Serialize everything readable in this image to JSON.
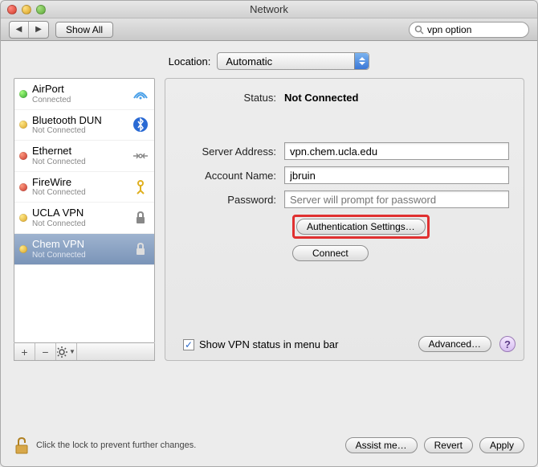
{
  "window": {
    "title": "Network"
  },
  "toolbar": {
    "show_all": "Show All",
    "search_value": "vpn option"
  },
  "location": {
    "label": "Location:",
    "value": "Automatic"
  },
  "services": [
    {
      "name": "AirPort",
      "status": "Connected",
      "dot": "green"
    },
    {
      "name": "Bluetooth DUN",
      "status": "Not Connected",
      "dot": "yellow"
    },
    {
      "name": "Ethernet",
      "status": "Not Connected",
      "dot": "red"
    },
    {
      "name": "FireWire",
      "status": "Not Connected",
      "dot": "red"
    },
    {
      "name": "UCLA VPN",
      "status": "Not Connected",
      "dot": "yellow"
    },
    {
      "name": "Chem VPN",
      "status": "Not Connected",
      "dot": "yellow"
    }
  ],
  "detail": {
    "status_label": "Status:",
    "status_value": "Not Connected",
    "server_label": "Server Address:",
    "server_value": "vpn.chem.ucla.edu",
    "account_label": "Account Name:",
    "account_value": "jbruin",
    "password_label": "Password:",
    "password_placeholder": "Server will prompt for password",
    "auth_settings": "Authentication Settings…",
    "connect": "Connect",
    "show_status": "Show VPN status in menu bar",
    "advanced": "Advanced…"
  },
  "footer": {
    "lock_text": "Click the lock to prevent further changes.",
    "assist": "Assist me…",
    "revert": "Revert",
    "apply": "Apply"
  }
}
